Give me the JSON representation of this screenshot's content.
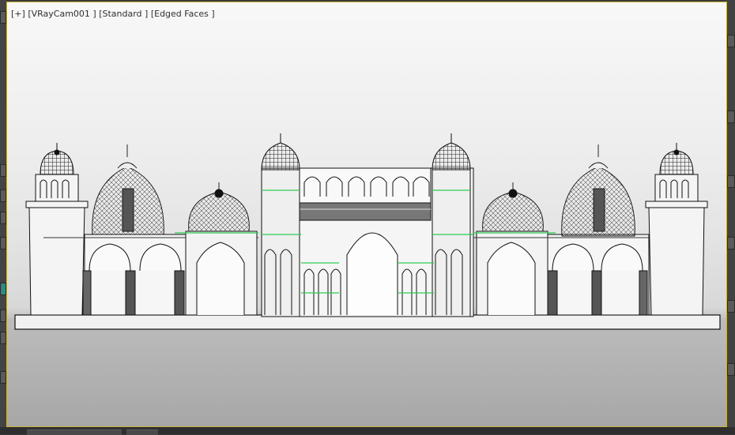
{
  "viewport": {
    "label_plus": "[+]",
    "label_camera": "[VRayCam001 ]",
    "label_shading": "[Standard ]",
    "label_edges": "[Edged Faces ]"
  },
  "colors": {
    "frame_highlight": "#c9b23a",
    "edge_highlight": "#2ecc55",
    "ui_background": "#3a3a3a"
  },
  "scene": {
    "object": "wireframe palace facade model with domes, minarets and arched gateway"
  }
}
